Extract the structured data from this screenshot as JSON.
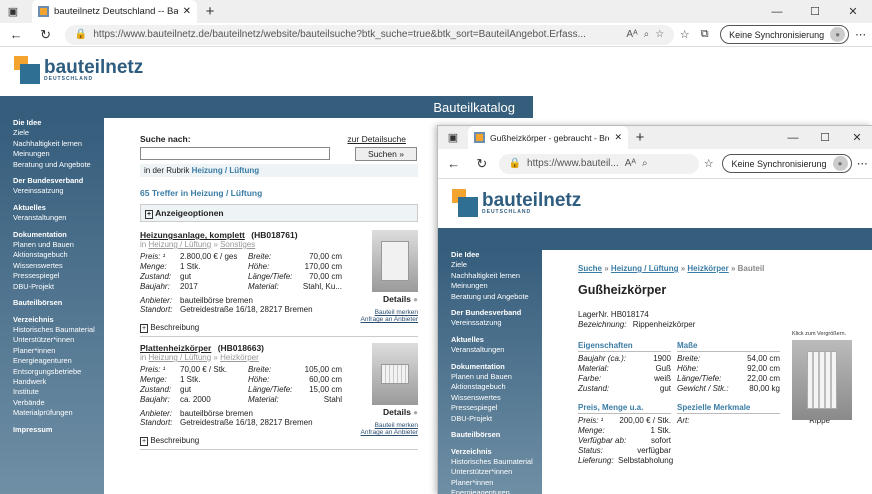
{
  "browser1": {
    "tab_title": "bauteilnetz Deutschland -- Baute",
    "url": "https://www.bauteilnetz.de/bauteilnetz/website/bauteilsuche?btk_suche=true&btk_sort=BauteilAngebot.Erfass...",
    "sync_label": "Keine Synchronisierung"
  },
  "browser2": {
    "tab_title": "Gußheizkörper - gebraucht - Bre",
    "url": "https://www.bauteil...",
    "sync_label": "Keine Synchronisierung"
  },
  "logo": {
    "name": "bauteilnetz",
    "sub": "DEUTSCHLAND"
  },
  "header": {
    "title": "Bauteilkatalog"
  },
  "nav": [
    {
      "label": "Die Idee",
      "head": true
    },
    {
      "label": "Ziele"
    },
    {
      "label": "Nachhaltigkeit lernen"
    },
    {
      "label": "Meinungen"
    },
    {
      "label": "Beratung und Angebote"
    },
    {
      "label": "Der Bundesverband",
      "head": true
    },
    {
      "label": "Vereinssatzung"
    },
    {
      "label": "Aktuelles",
      "head": true
    },
    {
      "label": "Veranstaltungen"
    },
    {
      "label": "Dokumentation",
      "head": true
    },
    {
      "label": "Planen und Bauen"
    },
    {
      "label": "Aktionstagebuch"
    },
    {
      "label": "Wissenswertes"
    },
    {
      "label": "Pressespiegel"
    },
    {
      "label": "DBU-Projekt"
    },
    {
      "label": "Bauteilbörsen",
      "head": true
    },
    {
      "label": "Verzeichnis",
      "head": true
    },
    {
      "label": "Historisches Baumaterial"
    },
    {
      "label": "Unterstützer*innen"
    },
    {
      "label": "Planer*innen"
    },
    {
      "label": "Energieagenturen"
    },
    {
      "label": "Entsorgungsbetriebe"
    },
    {
      "label": "Handwerk"
    },
    {
      "label": "Institute"
    },
    {
      "label": "Verbände"
    },
    {
      "label": "Materialprüfungen"
    },
    {
      "label": "Impressum",
      "head": true
    }
  ],
  "nav2": [
    {
      "label": "Die Idee",
      "head": true
    },
    {
      "label": "Ziele"
    },
    {
      "label": "Nachhaltigkeit lernen"
    },
    {
      "label": "Meinungen"
    },
    {
      "label": "Beratung und Angebote"
    },
    {
      "label": "Der Bundesverband",
      "head": true
    },
    {
      "label": "Vereinssatzung"
    },
    {
      "label": "Aktuelles",
      "head": true
    },
    {
      "label": "Veranstaltungen"
    },
    {
      "label": "Dokumentation",
      "head": true
    },
    {
      "label": "Planen und Bauen"
    },
    {
      "label": "Aktionstagebuch"
    },
    {
      "label": "Wissenswertes"
    },
    {
      "label": "Pressespiegel"
    },
    {
      "label": "DBU-Projekt"
    },
    {
      "label": "Bauteilbörsen",
      "head": true
    },
    {
      "label": "Verzeichnis",
      "head": true
    },
    {
      "label": "Historisches Baumaterial"
    },
    {
      "label": "Unterstützer*innen"
    },
    {
      "label": "Planer*innen"
    },
    {
      "label": "Energieagenturen"
    }
  ],
  "search": {
    "label": "Suche nach:",
    "detail_link": "zur Detailsuche",
    "button": "Suchen »",
    "rubric_prefix": "in der Rubrik",
    "rubric": "Heizung / Lüftung",
    "hits": "65 Treffer in Heizung / Lüftung",
    "options": "Anzeigeoptionen"
  },
  "listings": [
    {
      "title": "Heizungsanlage, komplett",
      "id": "(HB018761)",
      "crumb_prefix": "in",
      "crumb1": "Heizung / Lüftung",
      "crumb2": "Sonstiges",
      "left": [
        [
          "Preis: ¹",
          "2.800,00 € / ges"
        ],
        [
          "Menge:",
          "1 Stk."
        ],
        [
          "Zustand:",
          "gut"
        ],
        [
          "Baujahr:",
          "2017"
        ]
      ],
      "right": [
        [
          "Breite:",
          "70,00 cm"
        ],
        [
          "Höhe:",
          "170,00 cm"
        ],
        [
          "Länge/Tiefe:",
          "70,00 cm"
        ],
        [
          "Material:",
          "Stahl, Ku..."
        ]
      ],
      "provider_label": "Anbieter:",
      "provider": "bauteilbörse bremen",
      "location_label": "Standort:",
      "location": "Getreidestraße 16/18, 28217 Bremen",
      "details": "Details",
      "remember": "Bauteil merken",
      "request": "Anfrage an Anbieter",
      "desc": "Beschreibung"
    },
    {
      "title": "Plattenheizkörper",
      "id": "(HB018663)",
      "crumb_prefix": "in",
      "crumb1": "Heizung / Lüftung",
      "crumb2": "Heizkörper",
      "left": [
        [
          "Preis: ¹",
          "70,00 € / Stk."
        ],
        [
          "Menge:",
          "1 Stk."
        ],
        [
          "Zustand:",
          "gut"
        ],
        [
          "Baujahr:",
          "ca. 2000"
        ]
      ],
      "right": [
        [
          "Breite:",
          "105,00 cm"
        ],
        [
          "Höhe:",
          "60,00 cm"
        ],
        [
          "Länge/Tiefe:",
          "15,00 cm"
        ],
        [
          "Material:",
          "Stahl"
        ]
      ],
      "provider_label": "Anbieter:",
      "provider": "bauteilbörse bremen",
      "location_label": "Standort:",
      "location": "Getreidestraße 16/18, 28217 Bremen",
      "details": "Details",
      "remember": "Bauteil merken",
      "request": "Anfrage an Anbieter",
      "desc": "Beschreibung"
    }
  ],
  "detail": {
    "crumb": [
      "Suche",
      "Heizung / Lüftung",
      "Heizkörper",
      "Bauteil"
    ],
    "title": "Gußheizkörper",
    "lager_label": "LagerNr.",
    "lager": "HB018174",
    "bez_label": "Bezeichnung:",
    "bez": "Rippenheizkörper",
    "zoom": "Klick zum Vergrößern.",
    "props_title": "Eigenschaften",
    "props": [
      [
        "Baujahr (ca.):",
        "1900"
      ],
      [
        "Material:",
        "Guß"
      ],
      [
        "Farbe:",
        "weiß"
      ],
      [
        "Zustand:",
        "gut"
      ]
    ],
    "dims_title": "Maße",
    "dims": [
      [
        "Breite:",
        "54,00 cm"
      ],
      [
        "Höhe:",
        "92,00 cm"
      ],
      [
        "Länge/Tiefe:",
        "22,00 cm"
      ],
      [
        "Gewicht / Stk.:",
        "80,00 kg"
      ]
    ],
    "price_title": "Preis, Menge u.a.",
    "price": [
      [
        "Preis: ¹",
        "200,00 € / Stk."
      ],
      [
        "Menge:",
        "1 Stk."
      ],
      [
        "Verfügbar ab:",
        "sofort"
      ],
      [
        "Status:",
        "verfügbar"
      ],
      [
        "Lieferung:",
        "Selbstabholung"
      ]
    ],
    "special_title": "Spezielle Merkmale",
    "special": [
      [
        "Art:",
        "Rippe"
      ]
    ]
  },
  "colors": {
    "navy": "#355d7c",
    "accent": "#f2a42e",
    "link": "#3a7ca5"
  }
}
